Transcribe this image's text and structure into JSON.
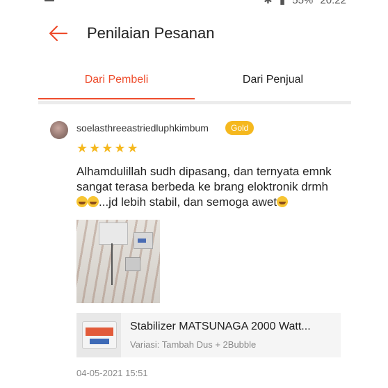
{
  "status_bar": {
    "battery": "55%",
    "time": "20:22"
  },
  "header": {
    "back_icon": "arrow-left-icon",
    "title": "Penilaian Pesanan"
  },
  "tabs": [
    {
      "label": "Dari Pembeli",
      "active": true
    },
    {
      "label": "Dari Penjual",
      "active": false
    }
  ],
  "review": {
    "username": "soelasthreeastriedluphkimbum",
    "badge": "Gold",
    "rating": 5,
    "comment_line1": "Alhamdulillah sudh dipasang, dan ternyata emnk",
    "comment_line2": "sangat terasa berbeda ke brang eloktronik drmh",
    "comment_line3": "...jd lebih stabil, dan semoga awet",
    "product": {
      "name": "Stabilizer MATSUNAGA 2000 Watt...",
      "variant": "Variasi: Tambah Dus + 2Bubble"
    },
    "timestamp": "04-05-2021 15:51"
  },
  "colors": {
    "accent": "#ee4d2d",
    "star": "#f5b81e",
    "badge": "#f5b81e"
  }
}
